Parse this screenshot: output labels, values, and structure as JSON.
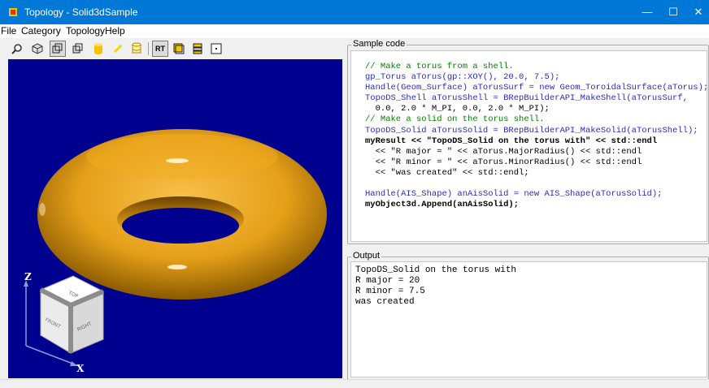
{
  "window": {
    "title": "Topology - Solid3dSample",
    "minimize_glyph": "—",
    "maximize_glyph": "☐",
    "close_glyph": "✕"
  },
  "menu": [
    "File",
    "Category",
    "Topology",
    "Help"
  ],
  "toolbar": {
    "buttons": [
      {
        "icon": "zoom-icon"
      },
      {
        "icon": "view-cube-icon"
      },
      {
        "icon": "wireframe-box-icon"
      },
      {
        "icon": "shaded-box-icon"
      },
      {
        "icon": "solid-cylinder-icon"
      },
      {
        "icon": "pencil-icon"
      },
      {
        "icon": "cylinder-outline-icon"
      },
      {
        "icon": "render-tracing-label",
        "label": "RT"
      },
      {
        "icon": "window-icon"
      },
      {
        "icon": "layers-icon"
      },
      {
        "icon": "fit-all-icon"
      }
    ]
  },
  "viewer": {
    "background": "#00008f",
    "torus_color": "#f2a81e",
    "view_cube": {
      "top": "TOP",
      "front": "FRONT",
      "right": "RIGHT",
      "axis_z": "Z",
      "axis_x": "X"
    }
  },
  "sample_code": {
    "title": "Sample code",
    "lines": [
      "// Make a torus from a shell.",
      "gp_Torus aTorus(gp::XOY(), 20.0, 7.5);",
      "Handle(Geom_Surface) aTorusSurf = new Geom_ToroidalSurface(aTorus);",
      "TopoDS_Shell aTorusShell = BRepBuilderAPI_MakeShell(aTorusSurf,",
      "  0.0, 2.0 * M_PI, 0.0, 2.0 * M_PI);",
      "// Make a solid on the torus shell.",
      "TopoDS_Solid aTorusSolid = BRepBuilderAPI_MakeSolid(aTorusShell);",
      "myResult << \"TopoDS_Solid on the torus with\" << std::endl",
      "  << \"R major = \" << aTorus.MajorRadius() << std::endl",
      "  << \"R minor = \" << aTorus.MinorRadius() << std::endl",
      "  << \"was created\" << std::endl;",
      "",
      "Handle(AIS_Shape) anAisSolid = new AIS_Shape(aTorusSolid);",
      "myObject3d.Append(anAisSolid);"
    ]
  },
  "output": {
    "title": "Output",
    "lines": [
      "TopoDS_Solid on the torus with",
      "R major = 20",
      "R minor = 7.5",
      "was created"
    ]
  }
}
